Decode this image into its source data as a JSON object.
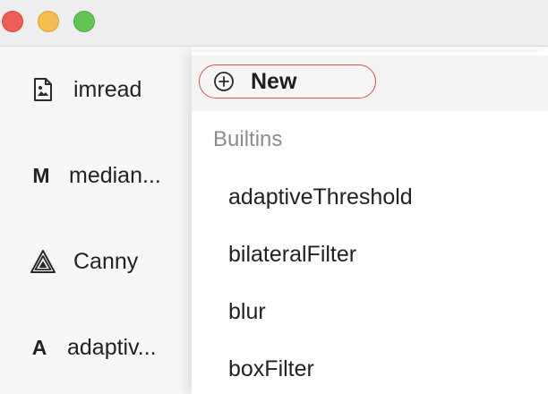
{
  "window": {
    "controls": [
      "close",
      "minimize",
      "maximize"
    ]
  },
  "sidebar": {
    "nodes": [
      {
        "icon": "image-file-icon",
        "label": "imread"
      },
      {
        "letter": "M",
        "label": "median..."
      },
      {
        "icon": "triangle-canny-icon",
        "label": "Canny"
      },
      {
        "letter": "A",
        "label": "adaptiv..."
      }
    ]
  },
  "menu": {
    "new_label": "New",
    "section_title": "Builtins",
    "items": [
      "adaptiveThreshold",
      "bilateralFilter",
      "blur",
      "boxFilter"
    ]
  },
  "colors": {
    "new_button_border": "#e0524c",
    "traffic_close": "#ee5d56",
    "traffic_minimize": "#f5bd4f",
    "traffic_maximize": "#61c554"
  }
}
